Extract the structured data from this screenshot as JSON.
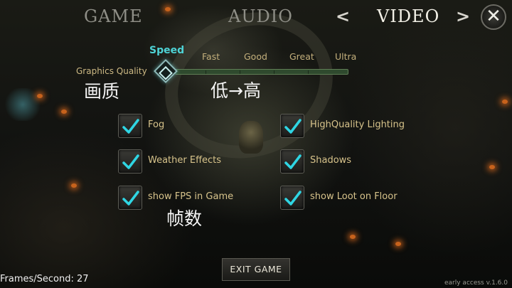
{
  "tabs": {
    "game": "GAME",
    "audio": "AUDIO",
    "video": "VIDEO"
  },
  "nav": {
    "prev": "<",
    "next": ">",
    "close": "✕"
  },
  "quality": {
    "label": "Graphics Quality",
    "options": [
      "Speed",
      "Fast",
      "Good",
      "Great",
      "Ultra"
    ],
    "selected": "Speed"
  },
  "annotations": {
    "quality": "画质",
    "range": "低→高",
    "fps": "帧数"
  },
  "options": [
    {
      "label": "Fog",
      "checked": true
    },
    {
      "label": "HighQuality Lighting",
      "checked": true
    },
    {
      "label": "Weather Effects",
      "checked": true
    },
    {
      "label": "Shadows",
      "checked": true
    },
    {
      "label": "show FPS in Game",
      "checked": true
    },
    {
      "label": "show Loot on Floor",
      "checked": true
    }
  ],
  "exit_label": "EXIT GAME",
  "fps_readout": "Frames/Second: 27",
  "version": "early access v.1.6.0",
  "colors": {
    "accent": "#4ed3d6",
    "label": "#d7c38b",
    "check": "#2fd6e4"
  }
}
